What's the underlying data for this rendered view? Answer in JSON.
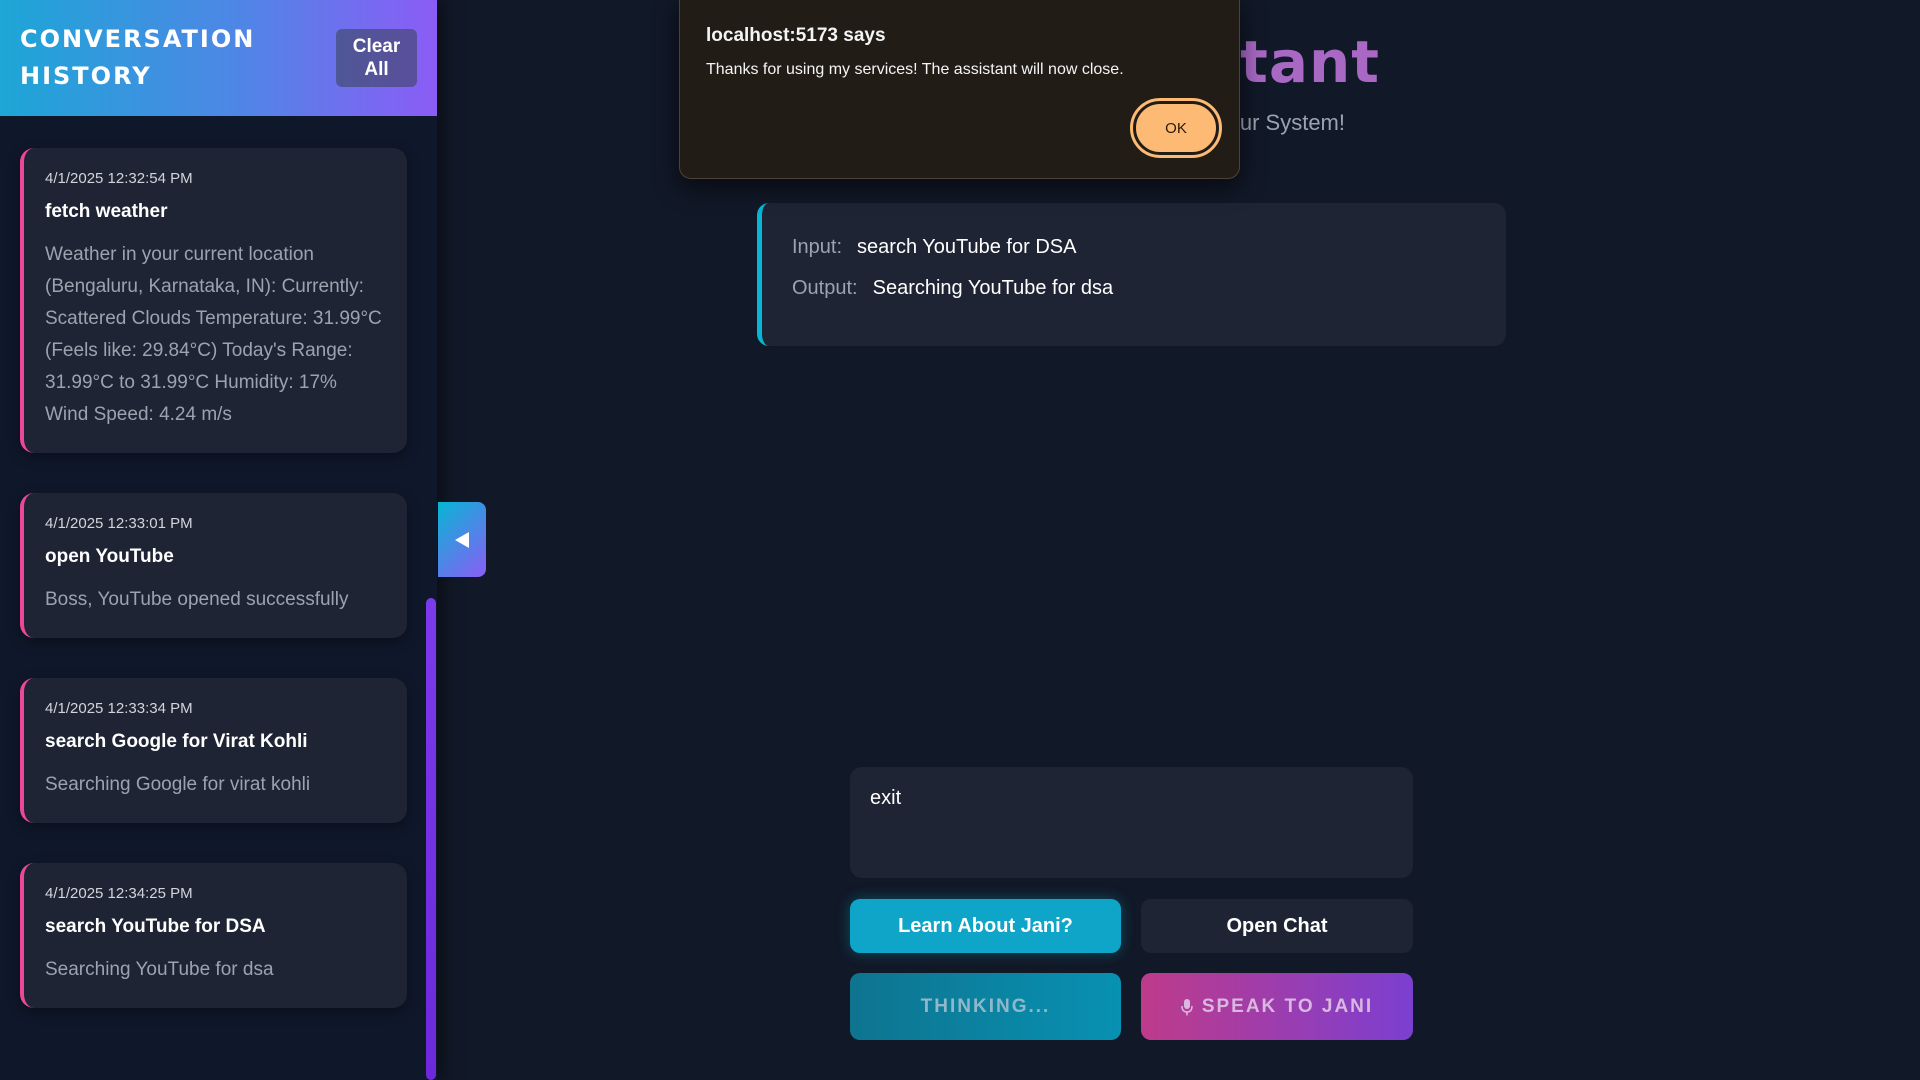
{
  "sidebar": {
    "title": "CONVERSATION HISTORY",
    "clear_label": "Clear All",
    "items": [
      {
        "time": "4/1/2025 12:32:54 PM",
        "command": "fetch weather",
        "response": "Weather in your current location (Bengaluru, Karnataka, IN): Currently: Scattered Clouds Temperature: 31.99°C (Feels like: 29.84°C) Today's Range: 31.99°C to 31.99°C Humidity: 17% Wind Speed: 4.24 m/s"
      },
      {
        "time": "4/1/2025 12:33:01 PM",
        "command": "open YouTube",
        "response": "Boss, YouTube opened successfully"
      },
      {
        "time": "4/1/2025 12:33:34 PM",
        "command": "search Google for Virat Kohli",
        "response": "Searching Google for virat kohli"
      },
      {
        "time": "4/1/2025 12:34:25 PM",
        "command": "search YouTube for DSA",
        "response": "Searching YouTube for dsa"
      }
    ],
    "toggle_icon": "chevron-left-icon"
  },
  "main": {
    "title_visible": "stant",
    "subtitle_visible": "ur System!",
    "io": {
      "input_label": "Input:",
      "input_value": "search YouTube for DSA",
      "output_label": "Output:",
      "output_value": "Searching YouTube for dsa"
    },
    "command_value": "exit",
    "buttons": {
      "learn": "Learn About Jani?",
      "chat": "Open Chat",
      "thinking": "THINKING...",
      "speak": "SPEAK TO JANI"
    }
  },
  "dialog": {
    "title": "localhost:5173 says",
    "message": "Thanks for using my services! The assistant will now close.",
    "ok_label": "OK"
  },
  "colors": {
    "accent_cyan": "#06b6d4",
    "accent_pink": "#ec4899",
    "accent_purple": "#8b5cf6",
    "dialog_button": "#fdba74"
  }
}
